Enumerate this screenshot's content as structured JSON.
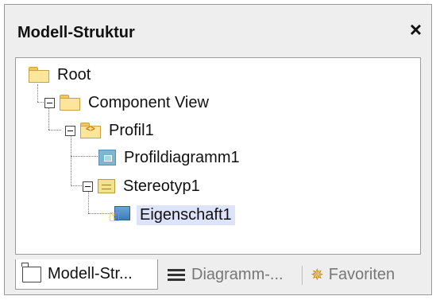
{
  "window": {
    "title": "Modell-Struktur",
    "close_glyph": "×"
  },
  "tree": {
    "nodes": [
      {
        "label": "Root",
        "icon": "folder-icon"
      },
      {
        "label": "Component View",
        "icon": "folder-icon"
      },
      {
        "label": "Profil1",
        "icon": "profile-package-icon",
        "icon_text": "<>"
      },
      {
        "label": "Profildiagramm1",
        "icon": "profile-diagram-icon"
      },
      {
        "label": "Stereotyp1",
        "icon": "stereotype-icon"
      },
      {
        "label": "Eigenschaft1",
        "icon": "property-icon",
        "selected": true
      }
    ]
  },
  "tabs": [
    {
      "label": "Modell-Str...",
      "icon": "folder-outline-icon",
      "active": true
    },
    {
      "label": "Diagramm-...",
      "icon": "diagram-tree-icon",
      "active": false
    },
    {
      "label": "Favoriten",
      "icon": "favorites-icon",
      "active": false
    }
  ],
  "colors": {
    "selection": "#dde3f8",
    "folder": "#fde59a",
    "panel": "#eeeeee"
  }
}
